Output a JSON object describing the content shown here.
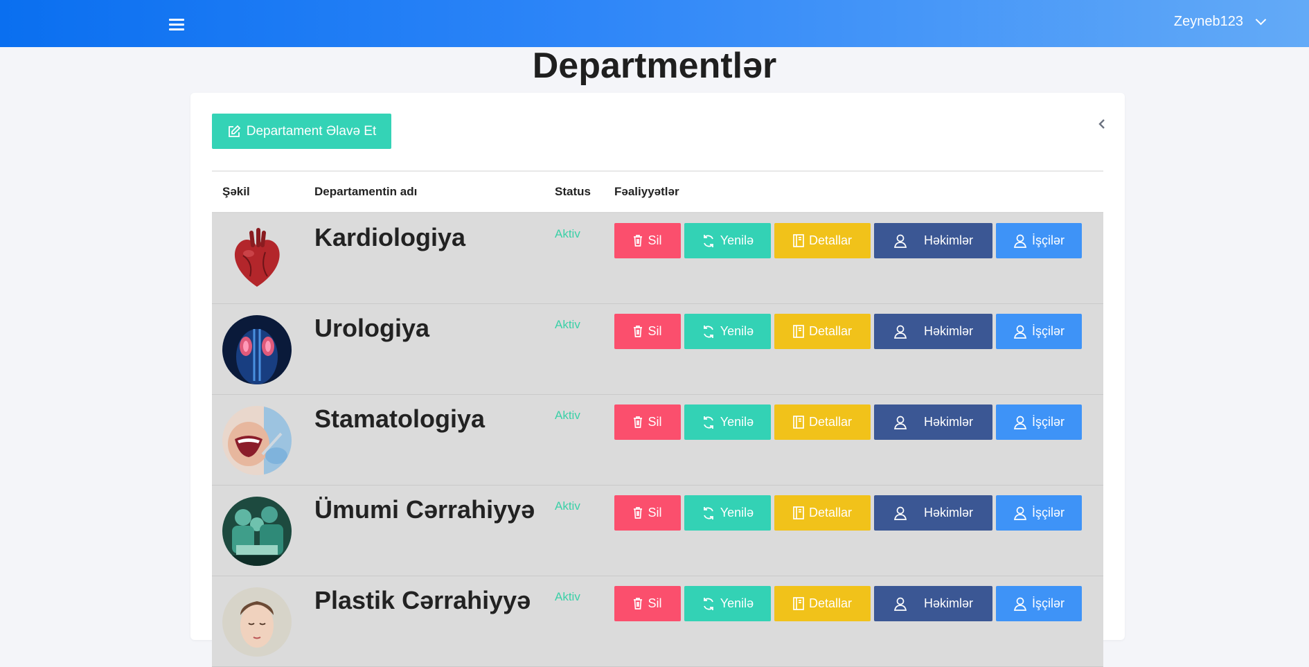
{
  "header": {
    "username": "Zeyneb123"
  },
  "page": {
    "title": "Departmentlər"
  },
  "toolbar": {
    "add_label": "Departament Əlavə Et"
  },
  "table": {
    "columns": [
      "Şəkil",
      "Departamentin adı",
      "Status",
      "Fəaliyyətlər"
    ],
    "actions": {
      "delete": "Sil",
      "update": "Yenilə",
      "details": "Detallar",
      "doctors": "Həkimlər",
      "workers": "İşçilər"
    },
    "rows": [
      {
        "name": "Kardiologiya",
        "status": "Aktiv",
        "image": "heart-image"
      },
      {
        "name": "Urologiya",
        "status": "Aktiv",
        "image": "kidney-xray-image"
      },
      {
        "name": "Stamatologiya",
        "status": "Aktiv",
        "image": "dental-image"
      },
      {
        "name": "Ümumi Cərrahiyyə",
        "status": "Aktiv",
        "image": "surgery-team-image"
      },
      {
        "name": "Plastik Cərrahiyyə",
        "status": "Aktiv",
        "image": "face-portrait-image"
      }
    ]
  },
  "colors": {
    "topbar_start": "#0a6ff0",
    "topbar_end": "#63aaf7",
    "delete": "#fb4f6d",
    "update": "#33d2b5",
    "details": "#f1c21a",
    "doctors": "#3b5794",
    "workers": "#3e93f7",
    "status_active": "#3ad0a7",
    "row_background": "#dbdbdb"
  }
}
